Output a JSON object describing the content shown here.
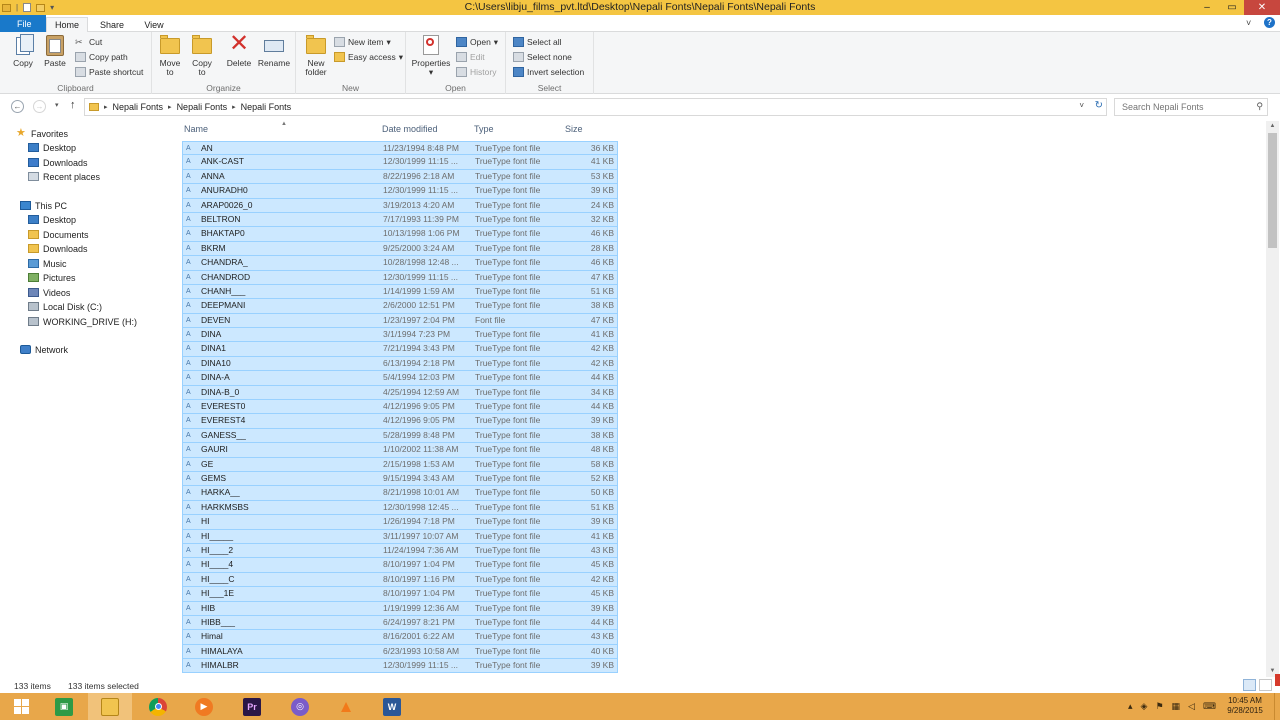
{
  "window": {
    "title": "C:\\Users\\libju_films_pvt.ltd\\Desktop\\Nepali Fonts\\Nepali Fonts\\Nepali Fonts",
    "controls": {
      "minimize": "–",
      "maximize": "▭",
      "close": "✕"
    }
  },
  "tabs": {
    "file": "File",
    "home": "Home",
    "share": "Share",
    "view": "View"
  },
  "ribbon": {
    "clipboard": {
      "label": "Clipboard",
      "copy": "Copy",
      "paste": "Paste",
      "cut": "Cut",
      "copy_path": "Copy path",
      "paste_shortcut": "Paste shortcut"
    },
    "organize": {
      "label": "Organize",
      "move_to_1": "Move",
      "move_to_2": "to",
      "copy_to_1": "Copy",
      "copy_to_2": "to",
      "delete": "Delete",
      "rename": "Rename"
    },
    "new": {
      "label": "New",
      "new_folder_1": "New",
      "new_folder_2": "folder",
      "new_item": "New item",
      "easy_access": "Easy access"
    },
    "open": {
      "label": "Open",
      "properties": "Properties",
      "open": "Open",
      "edit": "Edit",
      "history": "History"
    },
    "select": {
      "label": "Select",
      "select_all": "Select all",
      "select_none": "Select none",
      "invert_selection": "Invert selection"
    }
  },
  "address": {
    "crumbs": [
      "Nepali Fonts",
      "Nepali Fonts",
      "Nepali Fonts"
    ],
    "search_placeholder": "Search Nepali Fonts"
  },
  "nav": {
    "favorites": "Favorites",
    "desktop": "Desktop",
    "downloads": "Downloads",
    "recent_places": "Recent places",
    "this_pc": "This PC",
    "pc_desktop": "Desktop",
    "documents": "Documents",
    "pc_downloads": "Downloads",
    "music": "Music",
    "pictures": "Pictures",
    "videos": "Videos",
    "local_disk": "Local Disk (C:)",
    "working_drive": "WORKING_DRIVE (H:)",
    "network": "Network"
  },
  "columns": {
    "name": "Name",
    "date": "Date modified",
    "type": "Type",
    "size": "Size"
  },
  "files": [
    {
      "name": "AN",
      "date": "11/23/1994 8:48 PM",
      "type": "TrueType font file",
      "size": "36 KB"
    },
    {
      "name": "ANK-CAST",
      "date": "12/30/1999 11:15 ...",
      "type": "TrueType font file",
      "size": "41 KB"
    },
    {
      "name": "ANNA",
      "date": "8/22/1996 2:18 AM",
      "type": "TrueType font file",
      "size": "53 KB"
    },
    {
      "name": "ANURADH0",
      "date": "12/30/1999 11:15 ...",
      "type": "TrueType font file",
      "size": "39 KB"
    },
    {
      "name": "ARAP0026_0",
      "date": "3/19/2013 4:20 AM",
      "type": "TrueType font file",
      "size": "24 KB"
    },
    {
      "name": "BELTRON",
      "date": "7/17/1993 11:39 PM",
      "type": "TrueType font file",
      "size": "32 KB"
    },
    {
      "name": "BHAKTAP0",
      "date": "10/13/1998 1:06 PM",
      "type": "TrueType font file",
      "size": "46 KB"
    },
    {
      "name": "BKRM",
      "date": "9/25/2000 3:24 AM",
      "type": "TrueType font file",
      "size": "28 KB"
    },
    {
      "name": "CHANDRA_",
      "date": "10/28/1998 12:48 ...",
      "type": "TrueType font file",
      "size": "46 KB"
    },
    {
      "name": "CHANDROD",
      "date": "12/30/1999 11:15 ...",
      "type": "TrueType font file",
      "size": "47 KB"
    },
    {
      "name": "CHANH___",
      "date": "1/14/1999 1:59 AM",
      "type": "TrueType font file",
      "size": "51 KB"
    },
    {
      "name": "DEEPMANI",
      "date": "2/6/2000 12:51 PM",
      "type": "TrueType font file",
      "size": "38 KB"
    },
    {
      "name": "DEVEN",
      "date": "1/23/1997 2:04 PM",
      "type": "Font file",
      "size": "47 KB"
    },
    {
      "name": "DINA",
      "date": "3/1/1994 7:23 PM",
      "type": "TrueType font file",
      "size": "41 KB"
    },
    {
      "name": "DINA1",
      "date": "7/21/1994 3:43 PM",
      "type": "TrueType font file",
      "size": "42 KB"
    },
    {
      "name": "DINA10",
      "date": "6/13/1994 2:18 PM",
      "type": "TrueType font file",
      "size": "42 KB"
    },
    {
      "name": "DINA-A",
      "date": "5/4/1994 12:03 PM",
      "type": "TrueType font file",
      "size": "44 KB"
    },
    {
      "name": "DINA-B_0",
      "date": "4/25/1994 12:59 AM",
      "type": "TrueType font file",
      "size": "34 KB"
    },
    {
      "name": "EVEREST0",
      "date": "4/12/1996 9:05 PM",
      "type": "TrueType font file",
      "size": "44 KB"
    },
    {
      "name": "EVEREST4",
      "date": "4/12/1996 9:05 PM",
      "type": "TrueType font file",
      "size": "39 KB"
    },
    {
      "name": "GANESS__",
      "date": "5/28/1999 8:48 PM",
      "type": "TrueType font file",
      "size": "38 KB"
    },
    {
      "name": "GAURI",
      "date": "1/10/2002 11:38 AM",
      "type": "TrueType font file",
      "size": "48 KB"
    },
    {
      "name": "GE",
      "date": "2/15/1998 1:53 AM",
      "type": "TrueType font file",
      "size": "58 KB"
    },
    {
      "name": "GEMS",
      "date": "9/15/1994 3:43 AM",
      "type": "TrueType font file",
      "size": "52 KB"
    },
    {
      "name": "HARKA__",
      "date": "8/21/1998 10:01 AM",
      "type": "TrueType font file",
      "size": "50 KB"
    },
    {
      "name": "HARKMSBS",
      "date": "12/30/1998 12:45 ...",
      "type": "TrueType font file",
      "size": "51 KB"
    },
    {
      "name": "HI",
      "date": "1/26/1994 7:18 PM",
      "type": "TrueType font file",
      "size": "39 KB"
    },
    {
      "name": "HI_____",
      "date": "3/11/1997 10:07 AM",
      "type": "TrueType font file",
      "size": "41 KB"
    },
    {
      "name": "HI____2",
      "date": "11/24/1994 7:36 AM",
      "type": "TrueType font file",
      "size": "43 KB"
    },
    {
      "name": "HI____4",
      "date": "8/10/1997 1:04 PM",
      "type": "TrueType font file",
      "size": "45 KB"
    },
    {
      "name": "HI____C",
      "date": "8/10/1997 1:16 PM",
      "type": "TrueType font file",
      "size": "42 KB"
    },
    {
      "name": "HI___1E",
      "date": "8/10/1997 1:04 PM",
      "type": "TrueType font file",
      "size": "45 KB"
    },
    {
      "name": "HIB",
      "date": "1/19/1999 12:36 AM",
      "type": "TrueType font file",
      "size": "39 KB"
    },
    {
      "name": "HIBB___",
      "date": "6/24/1997 8:21 PM",
      "type": "TrueType font file",
      "size": "44 KB"
    },
    {
      "name": "Himal",
      "date": "8/16/2001 6:22 AM",
      "type": "TrueType font file",
      "size": "43 KB"
    },
    {
      "name": "HIMALAYA",
      "date": "6/23/1993 10:58 AM",
      "type": "TrueType font file",
      "size": "40 KB"
    },
    {
      "name": "HIMALBR",
      "date": "12/30/1999 11:15 ...",
      "type": "TrueType font file",
      "size": "39 KB"
    }
  ],
  "status": {
    "items": "133 items",
    "selected": "133 items selected"
  },
  "taskbar": {
    "clock_time": "10:45 AM",
    "clock_date": "9/28/2015",
    "premiere_label": "Pr",
    "word_label": "W"
  }
}
